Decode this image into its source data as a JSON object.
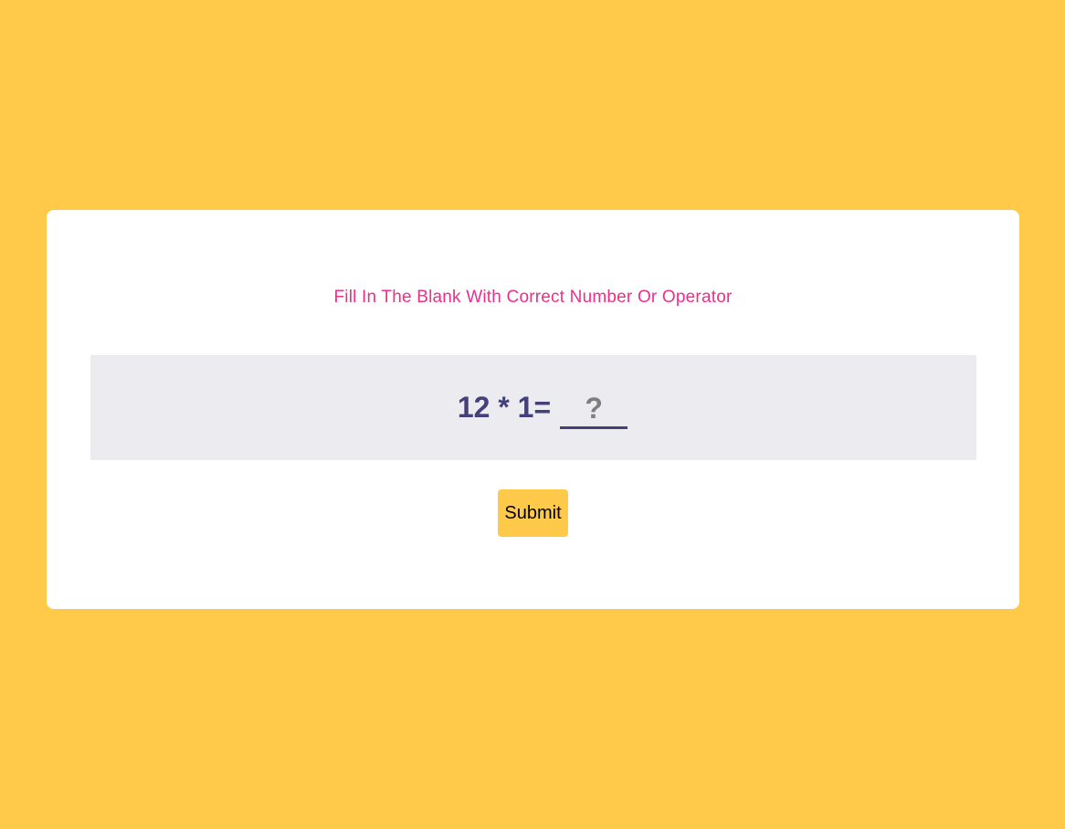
{
  "quiz": {
    "instruction": "Fill In The Blank With Correct Number Or Operator",
    "equation": "12 * 1=",
    "answer_value": "",
    "answer_placeholder": "?",
    "submit_label": "Submit"
  },
  "colors": {
    "background": "#ffca4a",
    "card": "#ffffff",
    "instruction_text": "#ec2f8a",
    "question_panel": "#ecebf0",
    "equation_text": "#44407a",
    "submit_button": "#ffca4a"
  }
}
